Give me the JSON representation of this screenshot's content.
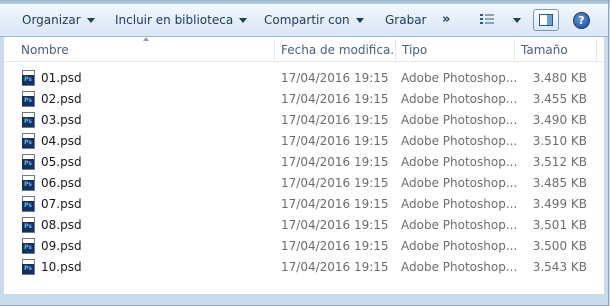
{
  "toolbar": {
    "organize": "Organizar",
    "include_library": "Incluir en biblioteca",
    "share_with": "Compartir con",
    "burn": "Grabar",
    "more": "»",
    "help_glyph": "?"
  },
  "columns": {
    "name": "Nombre",
    "date": "Fecha de modifica...",
    "type": "Tipo",
    "size": "Tamaño"
  },
  "files": [
    {
      "name": "01.psd",
      "date": "17/04/2016 19:15",
      "type": "Adobe Photoshop...",
      "size": "3.480 KB"
    },
    {
      "name": "02.psd",
      "date": "17/04/2016 19:15",
      "type": "Adobe Photoshop...",
      "size": "3.455 KB"
    },
    {
      "name": "03.psd",
      "date": "17/04/2016 19:15",
      "type": "Adobe Photoshop...",
      "size": "3.490 KB"
    },
    {
      "name": "04.psd",
      "date": "17/04/2016 19:15",
      "type": "Adobe Photoshop...",
      "size": "3.510 KB"
    },
    {
      "name": "05.psd",
      "date": "17/04/2016 19:15",
      "type": "Adobe Photoshop...",
      "size": "3.512 KB"
    },
    {
      "name": "06.psd",
      "date": "17/04/2016 19:15",
      "type": "Adobe Photoshop...",
      "size": "3.485 KB"
    },
    {
      "name": "07.psd",
      "date": "17/04/2016 19:15",
      "type": "Adobe Photoshop...",
      "size": "3.499 KB"
    },
    {
      "name": "08.psd",
      "date": "17/04/2016 19:15",
      "type": "Adobe Photoshop...",
      "size": "3.501 KB"
    },
    {
      "name": "09.psd",
      "date": "17/04/2016 19:15",
      "type": "Adobe Photoshop...",
      "size": "3.500 KB"
    },
    {
      "name": "10.psd",
      "date": "17/04/2016 19:15",
      "type": "Adobe Photoshop...",
      "size": "3.543 KB"
    }
  ],
  "icons": {
    "file": "photoshop-file-icon",
    "file_badge": "Ps",
    "view": "view-options-icon",
    "preview_pane": "preview-pane-icon",
    "help": "help-icon"
  },
  "colors": {
    "toolbar_text": "#1e3a5c",
    "frame": "#c9daea",
    "accent": "#1b4c97"
  }
}
